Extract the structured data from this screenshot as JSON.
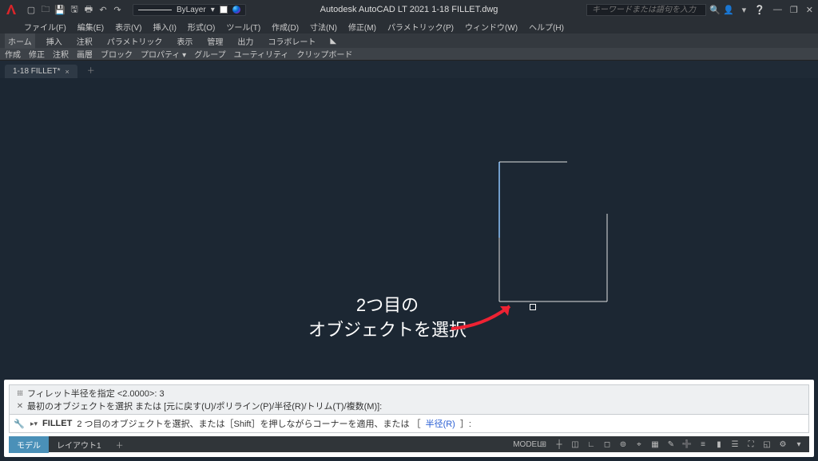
{
  "app": {
    "title": "Autodesk AutoCAD LT 2021   1-18 FILLET.dwg",
    "logo": "A"
  },
  "qat_icons": [
    "new",
    "open",
    "save",
    "saveas",
    "plot",
    "undo",
    "redo"
  ],
  "layer": {
    "name": "ByLayer",
    "dropdown": "▾"
  },
  "search": {
    "placeholder": "キーワードまたは語句を入力",
    "icon": "🔍"
  },
  "win_icons": [
    "👤",
    "▾",
    "❔",
    "—",
    "❐",
    "✕"
  ],
  "menu": [
    "ファイル(F)",
    "編集(E)",
    "表示(V)",
    "挿入(I)",
    "形式(O)",
    "ツール(T)",
    "作成(D)",
    "寸法(N)",
    "修正(M)",
    "パラメトリック(P)",
    "ウィンドウ(W)",
    "ヘルプ(H)"
  ],
  "ribbon_tabs": [
    "ホーム",
    "挿入",
    "注釈",
    "パラメトリック",
    "表示",
    "管理",
    "出力",
    "コラボレート",
    "◣"
  ],
  "ribbon_panels": [
    "作成",
    "修正",
    "注釈",
    "画層",
    "ブロック",
    "プロパティ ▾",
    "グループ",
    "ユーティリティ",
    "クリップボード"
  ],
  "doc_tab": {
    "label": "1-18 FILLET*",
    "close": "×",
    "plus": "＋"
  },
  "annotation": {
    "line1": "2つ目の",
    "line2": "オブジェクトを選択"
  },
  "cmd": {
    "hist1": "フィレット半径を指定 <2.0000>: 3",
    "hist2": "最初のオブジェクトを選択 または [元に戻す(U)/ポリライン(P)/半径(R)/トリム(T)/複数(M)]:",
    "prompt_pre": "FILLET",
    "prompt_mid": " 2 つ目のオブジェクトを選択、または［Shift］を押しながらコーナーを適用、または ［",
    "prompt_kw": "半径(R)",
    "prompt_post": "］:",
    "gutter_top": "᎒᎒᎒",
    "gutter_x": "✕",
    "wrench": "🔧",
    "caret": "▸▾"
  },
  "status": {
    "tabs": [
      "モデル",
      "レイアウト1"
    ],
    "plus": "＋",
    "right_icons": [
      "MODEL",
      "⊞",
      "┼",
      "◫",
      "∟",
      "◻",
      "⊚",
      "⌖",
      "▦",
      "✎",
      "➕",
      "≡",
      "▮",
      "☰",
      "⛶",
      "◱",
      "⚙",
      "▾"
    ]
  },
  "chart_data": null
}
